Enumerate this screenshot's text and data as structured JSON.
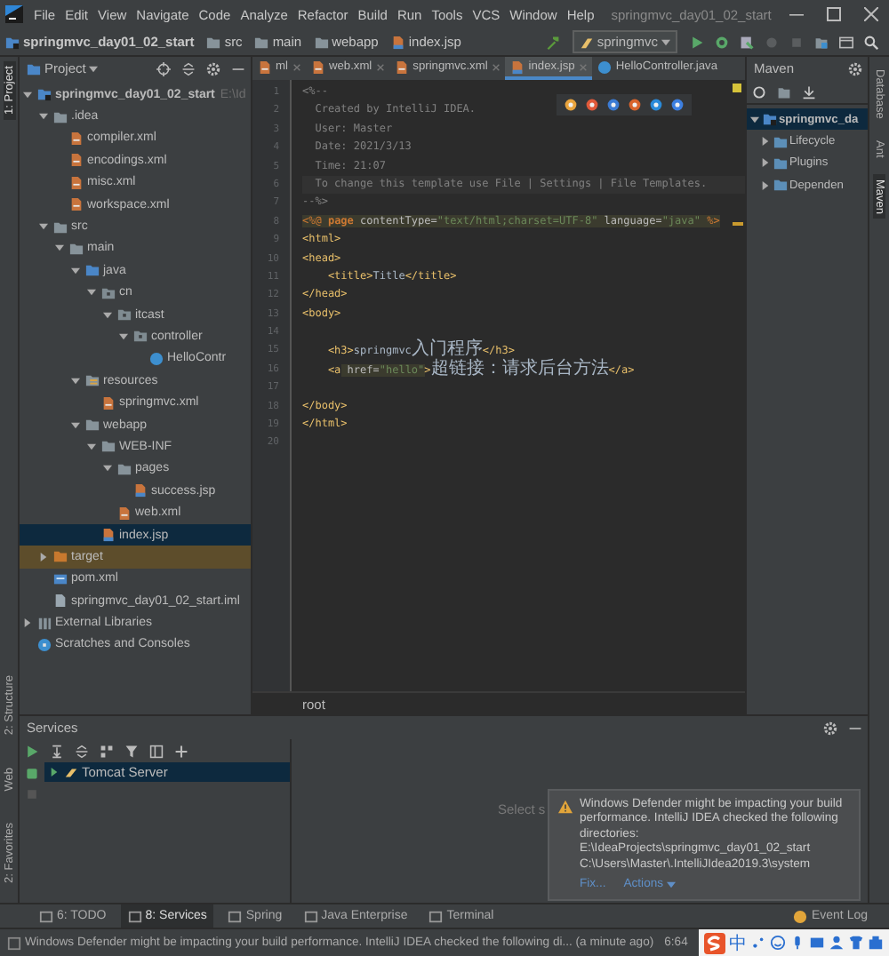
{
  "window": {
    "title": "springmvc_day01_02_start"
  },
  "menu": [
    "File",
    "Edit",
    "View",
    "Navigate",
    "Code",
    "Analyze",
    "Refactor",
    "Build",
    "Run",
    "Tools",
    "VCS",
    "Window",
    "Help"
  ],
  "navigation": {
    "breadcrumbs": [
      {
        "label": "springmvc_day01_02_start",
        "kind": "module"
      },
      {
        "label": "src",
        "kind": "folder"
      },
      {
        "label": "main",
        "kind": "folder"
      },
      {
        "label": "webapp",
        "kind": "folder"
      },
      {
        "label": "index.jsp",
        "kind": "jsp"
      }
    ],
    "run_config": "springmvc"
  },
  "left_strip": [
    {
      "label": "1: Project",
      "selected": true
    },
    {
      "label": "2: Structure",
      "selected": false
    },
    {
      "label": "Web",
      "selected": false
    },
    {
      "label": "2: Favorites",
      "selected": false
    }
  ],
  "project": {
    "title": "Project",
    "tree": [
      {
        "label": "springmvc_day01_02_start",
        "hint": "E:\\Id",
        "kind": "module",
        "expanded": true,
        "selected": false,
        "excluded": false,
        "children": [
          {
            "label": ".idea",
            "kind": "folder",
            "expanded": true,
            "selected": false,
            "excluded": false,
            "children": [
              {
                "label": "compiler.xml",
                "kind": "xml",
                "selected": false,
                "excluded": false
              },
              {
                "label": "encodings.xml",
                "kind": "xml",
                "selected": false,
                "excluded": false
              },
              {
                "label": "misc.xml",
                "kind": "xml",
                "selected": false,
                "excluded": false
              },
              {
                "label": "workspace.xml",
                "kind": "xml",
                "selected": false,
                "excluded": false
              }
            ]
          },
          {
            "label": "src",
            "kind": "folder",
            "expanded": true,
            "selected": false,
            "excluded": false,
            "children": [
              {
                "label": "main",
                "kind": "folder",
                "expanded": true,
                "selected": false,
                "excluded": false,
                "children": [
                  {
                    "label": "java",
                    "kind": "folder_src",
                    "expanded": true,
                    "selected": false,
                    "excluded": false,
                    "children": [
                      {
                        "label": "cn",
                        "kind": "package",
                        "expanded": true,
                        "selected": false,
                        "excluded": false,
                        "children": [
                          {
                            "label": "itcast",
                            "kind": "package",
                            "expanded": true,
                            "selected": false,
                            "excluded": false,
                            "children": [
                              {
                                "label": "controller",
                                "kind": "package",
                                "expanded": true,
                                "selected": false,
                                "excluded": false,
                                "children": [
                                  {
                                    "label": "HelloContr",
                                    "kind": "java",
                                    "selected": false,
                                    "excluded": false
                                  }
                                ]
                              }
                            ]
                          }
                        ]
                      }
                    ]
                  },
                  {
                    "label": "resources",
                    "kind": "folder_res",
                    "expanded": true,
                    "selected": false,
                    "excluded": false,
                    "children": [
                      {
                        "label": "springmvc.xml",
                        "kind": "xml",
                        "selected": false,
                        "excluded": false
                      }
                    ]
                  },
                  {
                    "label": "webapp",
                    "kind": "folder",
                    "expanded": true,
                    "selected": false,
                    "excluded": false,
                    "children": [
                      {
                        "label": "WEB-INF",
                        "kind": "folder",
                        "expanded": true,
                        "selected": false,
                        "excluded": false,
                        "children": [
                          {
                            "label": "pages",
                            "kind": "folder",
                            "expanded": true,
                            "selected": false,
                            "excluded": false,
                            "children": [
                              {
                                "label": "success.jsp",
                                "kind": "jsp",
                                "selected": false,
                                "excluded": false
                              }
                            ]
                          },
                          {
                            "label": "web.xml",
                            "kind": "xml",
                            "selected": false,
                            "excluded": false
                          }
                        ]
                      },
                      {
                        "label": "index.jsp",
                        "kind": "jsp",
                        "selected": true,
                        "excluded": false
                      }
                    ]
                  }
                ]
              }
            ]
          },
          {
            "label": "target",
            "kind": "folder_target",
            "expanded": false,
            "selected": false,
            "excluded": true
          },
          {
            "label": "pom.xml",
            "kind": "pom",
            "selected": false,
            "excluded": false
          },
          {
            "label": "springmvc_day01_02_start.iml",
            "kind": "iml",
            "selected": false,
            "excluded": false
          }
        ]
      },
      {
        "label": "External Libraries",
        "kind": "library",
        "expanded": false,
        "selected": false,
        "excluded": false
      },
      {
        "label": "Scratches and Consoles",
        "kind": "scratch",
        "selected": false,
        "excluded": false
      }
    ]
  },
  "editor": {
    "tabs": [
      {
        "label": "ml",
        "kind": "xml",
        "selected": false
      },
      {
        "label": "web.xml",
        "kind": "xml",
        "selected": false
      },
      {
        "label": "springmvc.xml",
        "kind": "xml",
        "selected": false
      },
      {
        "label": "index.jsp",
        "kind": "jsp",
        "selected": true
      },
      {
        "label": "HelloController.java",
        "kind": "java",
        "selected": false
      }
    ],
    "lines": [
      {
        "n": "1",
        "tokens": [
          {
            "kind": "comment",
            "text": "<%--"
          }
        ]
      },
      {
        "n": "2",
        "tokens": [
          {
            "kind": "comment",
            "text": "  Created by IntelliJ IDEA."
          }
        ]
      },
      {
        "n": "3",
        "tokens": [
          {
            "kind": "comment",
            "text": "  User: Master"
          }
        ]
      },
      {
        "n": "4",
        "tokens": [
          {
            "kind": "comment",
            "text": "  Date: 2021/3/13"
          }
        ]
      },
      {
        "n": "5",
        "tokens": [
          {
            "kind": "comment",
            "text": "  Time: 21:07"
          }
        ]
      },
      {
        "n": "6",
        "tokens": [
          {
            "kind": "comment",
            "text": "  To change this template use File | Settings | File Templates."
          }
        ]
      },
      {
        "n": "7",
        "tokens": [
          {
            "kind": "comment",
            "text": "--%>"
          }
        ]
      },
      {
        "n": "8",
        "tokens": [
          {
            "kind": "directive",
            "text": "<%@ "
          },
          {
            "kind": "keyword",
            "text": "page"
          },
          {
            "kind": "attr",
            "text": " contentType="
          },
          {
            "kind": "string",
            "text": "\"text/html;charset=UTF-8\""
          },
          {
            "kind": "attr",
            "text": " language="
          },
          {
            "kind": "string",
            "text": "\"java\""
          },
          {
            "kind": "directive",
            "text": " %>"
          }
        ]
      },
      {
        "n": "9",
        "tokens": [
          {
            "kind": "tag",
            "text": "<html>"
          }
        ]
      },
      {
        "n": "10",
        "tokens": [
          {
            "kind": "tag",
            "text": "<head>"
          }
        ]
      },
      {
        "n": "11",
        "tokens": [
          {
            "kind": "tag",
            "text": "    <title>"
          },
          {
            "kind": "text",
            "text": "Title"
          },
          {
            "kind": "tag",
            "text": "</title>"
          }
        ]
      },
      {
        "n": "12",
        "tokens": [
          {
            "kind": "tag",
            "text": "</head>"
          }
        ]
      },
      {
        "n": "13",
        "tokens": [
          {
            "kind": "tag",
            "text": "<body>"
          }
        ]
      },
      {
        "n": "14"
      },
      {
        "n": "15",
        "tokens": [
          {
            "kind": "tag",
            "text": "    <h3>"
          },
          {
            "kind": "text",
            "text": "springmvc"
          },
          {
            "kind": "cjk",
            "text": "入门程序"
          },
          {
            "kind": "tag",
            "text": "</h3>"
          }
        ]
      },
      {
        "n": "16",
        "tokens": [
          {
            "kind": "tag",
            "text": "    <a"
          },
          {
            "kind": "attr",
            "text": " href="
          },
          {
            "kind": "string",
            "text": "\"hello\""
          },
          {
            "kind": "tag",
            "text": ">"
          },
          {
            "kind": "cjk",
            "text": "超链接：请求后台方法"
          },
          {
            "kind": "tag",
            "text": "</a>"
          }
        ]
      },
      {
        "n": "17"
      },
      {
        "n": "18",
        "tokens": [
          {
            "kind": "tag",
            "text": "</body>"
          }
        ]
      },
      {
        "n": "19",
        "tokens": [
          {
            "kind": "tag",
            "text": "</html>"
          }
        ]
      },
      {
        "n": "20"
      }
    ],
    "breadcrumb": "root"
  },
  "maven": {
    "title": "Maven",
    "tree": [
      {
        "label": "springmvc_da",
        "kind": "module",
        "expanded": true,
        "selected": true,
        "children": [
          {
            "label": "Lifecycle",
            "kind": "mvn_folder",
            "expanded": false,
            "selected": false
          },
          {
            "label": "Plugins",
            "kind": "mvn_folder",
            "expanded": false,
            "selected": false
          },
          {
            "label": "Dependen",
            "kind": "mvn_folder",
            "expanded": false,
            "selected": false
          }
        ]
      }
    ]
  },
  "right_strip": [
    {
      "label": "Database",
      "selected": false
    },
    {
      "label": "Ant",
      "selected": false
    },
    {
      "label": "Maven",
      "selected": true
    }
  ],
  "services": {
    "title": "Services",
    "tree": [
      {
        "label": "Tomcat Server",
        "selected": true
      }
    ],
    "hint": "Select s"
  },
  "notification": {
    "message": "Windows Defender might be impacting your build performance. IntelliJ IDEA checked the following directories:",
    "paths": [
      "E:\\IdeaProjects\\springmvc_day01_02_start",
      "C:\\Users\\Master\\.IntelliJIdea2019.3\\system"
    ],
    "links": [
      "Fix...",
      "Actions"
    ]
  },
  "tool_tabs": [
    {
      "label": "6: TODO",
      "selected": false
    },
    {
      "label": "8: Services",
      "selected": true
    },
    {
      "label": "Spring",
      "selected": false
    },
    {
      "label": "Java Enterprise",
      "selected": false
    },
    {
      "label": "Terminal",
      "selected": false
    }
  ],
  "event_log": "Event Log",
  "status": {
    "message": "Windows Defender might be impacting your build performance. IntelliJ IDEA checked the following di... (a minute ago)",
    "position": "6:64"
  },
  "tray": {
    "ime": "中"
  }
}
